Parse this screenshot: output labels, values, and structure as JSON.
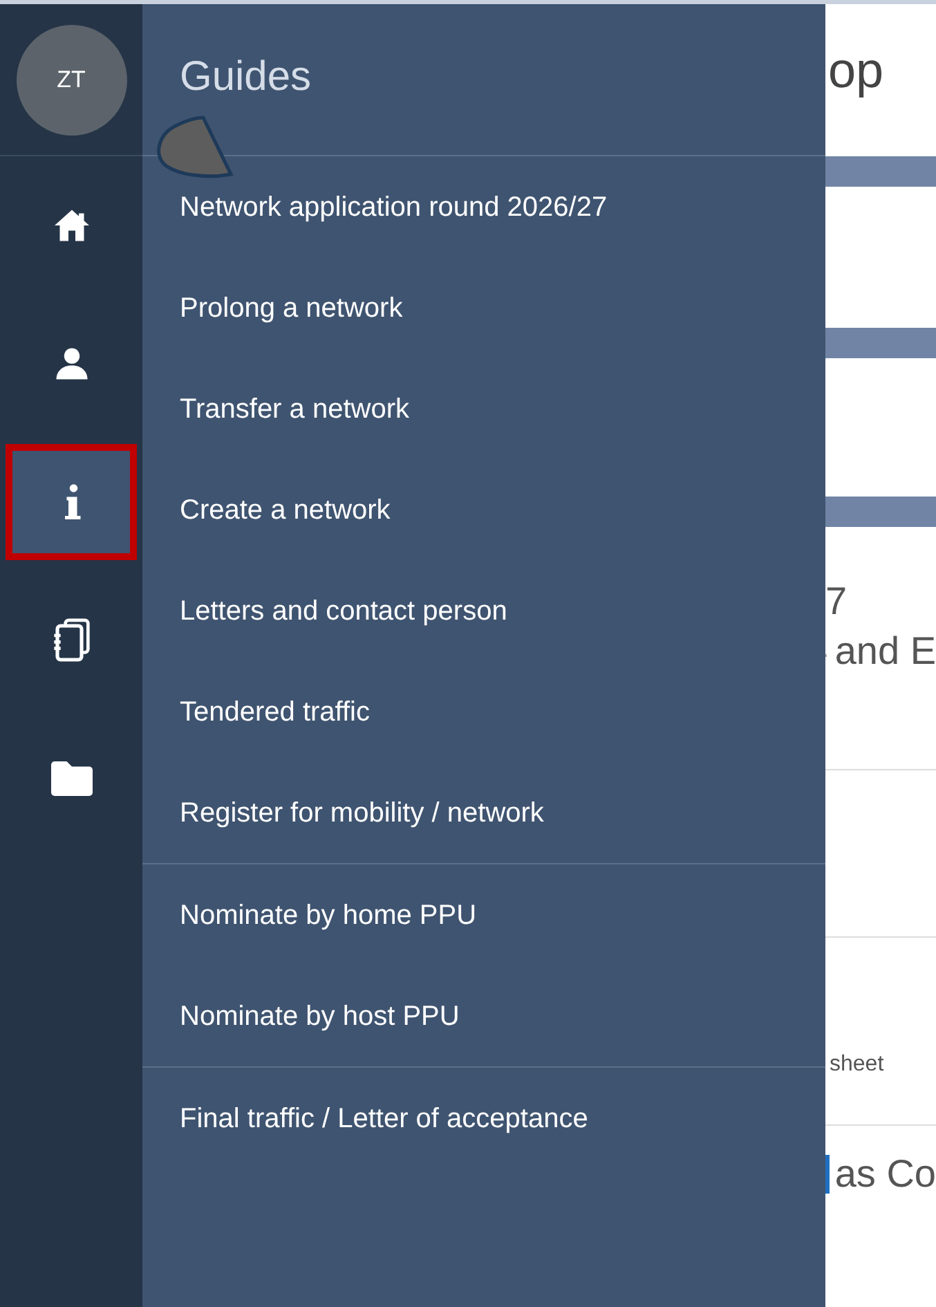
{
  "user": {
    "initials": "ZT"
  },
  "nav": [
    {
      "kind": "home",
      "selected": false
    },
    {
      "kind": "person",
      "selected": false
    },
    {
      "kind": "info",
      "selected": true
    },
    {
      "kind": "notebook",
      "selected": false
    },
    {
      "kind": "folder",
      "selected": false
    }
  ],
  "menu": {
    "title": "Guides",
    "groups": [
      [
        "Network application round 2026/27",
        "Prolong a network",
        "Transfer a network",
        "Create a network",
        "Letters and contact person",
        "Tendered traffic",
        "Register for mobility / network"
      ],
      [
        "Nominate by home PPU",
        "Nominate by host PPU"
      ],
      [
        "Final traffic / Letter of acceptance"
      ]
    ]
  },
  "background": {
    "title": "op",
    "texts": [
      "7",
      "and E",
      "sheet",
      "as Co"
    ]
  }
}
